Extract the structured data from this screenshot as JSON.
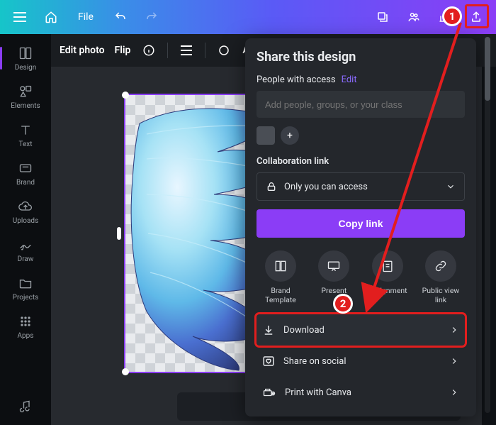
{
  "topbar": {
    "file_label": "File"
  },
  "sidebar": {
    "items": [
      {
        "label": "Design"
      },
      {
        "label": "Elements"
      },
      {
        "label": "Text"
      },
      {
        "label": "Brand"
      },
      {
        "label": "Uploads"
      },
      {
        "label": "Draw"
      },
      {
        "label": "Projects"
      },
      {
        "label": "Apps"
      }
    ]
  },
  "toolbar": {
    "edit_photo_label": "Edit photo",
    "flip_label": "Flip",
    "animate_label": "Anim"
  },
  "panel": {
    "title": "Share this design",
    "access_label": "People with access",
    "access_edit": "Edit",
    "add_placeholder": "Add people, groups, or your class",
    "collab_label": "Collaboration link",
    "select_value": "Only you can access",
    "copy_label": "Copy link",
    "tiles": [
      {
        "label": "Brand Template"
      },
      {
        "label": "Present"
      },
      {
        "label": "Assignment"
      },
      {
        "label": "Public view link"
      }
    ],
    "actions": [
      {
        "label": "Download"
      },
      {
        "label": "Share on social"
      },
      {
        "label": "Print with Canva"
      }
    ]
  },
  "annotation": {
    "m1": "1",
    "m2": "2"
  }
}
